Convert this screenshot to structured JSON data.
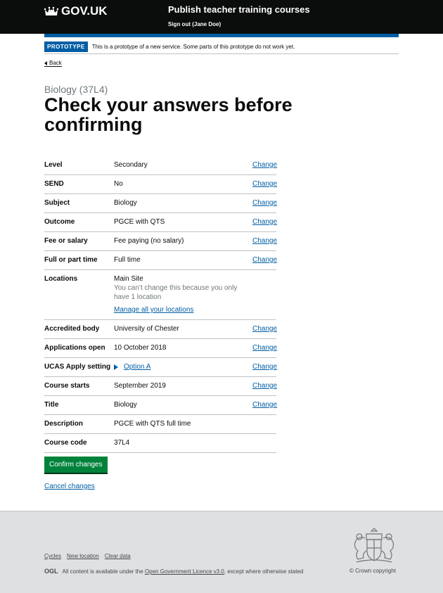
{
  "header": {
    "logo_text": "GOV.UK",
    "service_name": "Publish teacher training courses",
    "signout": "Sign out (Jane Doe)"
  },
  "banner": {
    "tag": "PROTOTYPE",
    "text": "This is a prototype of a new service. Some parts of this prototype do not work yet."
  },
  "back_link": "Back",
  "caption": "Biology (37L4)",
  "title": "Check your answers before confirming",
  "change_label": "Change",
  "rows": [
    {
      "key": "Level",
      "value": "Secondary"
    },
    {
      "key": "SEND",
      "value": "No"
    },
    {
      "key": "Subject",
      "value": "Biology"
    },
    {
      "key": "Outcome",
      "value": "PGCE with QTS"
    },
    {
      "key": "Fee or salary",
      "value": "Fee paying (no salary)"
    },
    {
      "key": "Full or part time",
      "value": "Full time"
    },
    {
      "key": "Locations",
      "value": "Main Site",
      "hint": "You can’t change this because you only have 1 location",
      "link": "Manage all your locations"
    },
    {
      "key": "Accredited body",
      "value": "University of Chester"
    },
    {
      "key": "Applications open",
      "value": "10 October 2018"
    },
    {
      "key": "UCAS Apply setting",
      "value": "Option A"
    },
    {
      "key": "Course starts",
      "value": "September 2019"
    },
    {
      "key": "Title",
      "value": "Biology"
    },
    {
      "key": "Description",
      "value": "PGCE with QTS full time"
    },
    {
      "key": "Course code",
      "value": "37L4"
    }
  ],
  "confirm_button": "Confirm changes",
  "cancel_link": "Cancel changes",
  "footer": {
    "links": [
      "Cycles",
      "New location",
      "Clear data"
    ],
    "ogl_logo": "OGL",
    "licence_prefix": "All content is available under the",
    "licence_link": "Open Government Licence v3.0",
    "licence_suffix": ", except where otherwise stated",
    "copyright": "© Crown copyright"
  },
  "colors": {
    "brand_blue": "#005ea5",
    "button_green": "#00823b",
    "header_black": "#0b0c0c"
  }
}
